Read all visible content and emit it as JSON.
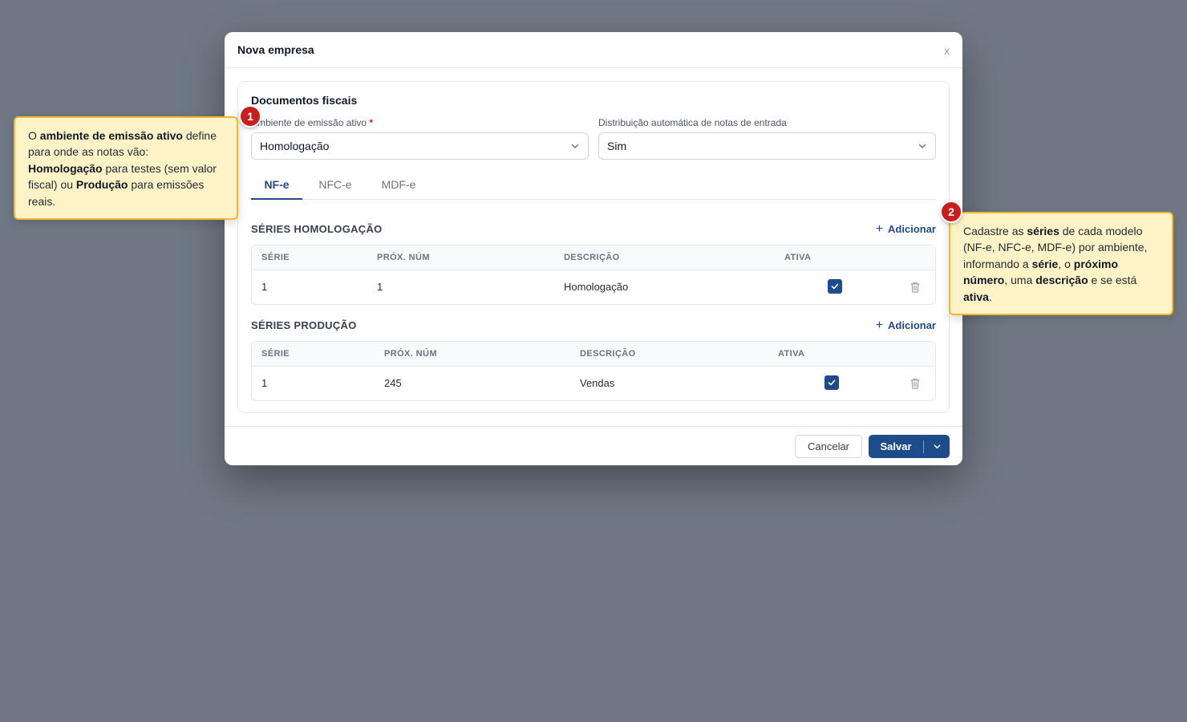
{
  "modal": {
    "title": "Nova empresa",
    "close_label": "x"
  },
  "card": {
    "title": "Documentos fiscais",
    "ambiente": {
      "label": "Ambiente de emissão ativo",
      "required_mark": "*",
      "value": "Homologação"
    },
    "distribuicao": {
      "label": "Distribuição automática de notas de entrada",
      "value": "Sim"
    },
    "tabs": [
      {
        "label": "NF-e",
        "active": true
      },
      {
        "label": "NFC-e",
        "active": false
      },
      {
        "label": "MDF-e",
        "active": false
      }
    ]
  },
  "series_homologacao": {
    "title": "SÉRIES HOMOLOGAÇÃO",
    "add_label": "Adicionar",
    "columns": [
      "SÉRIE",
      "PRÓX. NÚM",
      "DESCRIÇÃO",
      "ATIVA"
    ],
    "rows": [
      {
        "serie": "1",
        "prox_num": "1",
        "descricao": "Homologação",
        "ativa": true
      }
    ]
  },
  "series_producao": {
    "title": "SÉRIES PRODUÇÃO",
    "add_label": "Adicionar",
    "columns": [
      "SÉRIE",
      "PRÓX. NÚM",
      "DESCRIÇÃO",
      "ATIVA"
    ],
    "rows": [
      {
        "serie": "1",
        "prox_num": "245",
        "descricao": "Vendas",
        "ativa": true
      }
    ]
  },
  "footer": {
    "cancel_label": "Cancelar",
    "save_label": "Salvar"
  },
  "tooltips": [
    {
      "badge": "1",
      "segments": [
        {
          "text": "O ",
          "bold": false
        },
        {
          "text": "ambiente de emissão ativo",
          "bold": true
        },
        {
          "text": " define para onde as notas vão: ",
          "bold": false
        },
        {
          "text": "Homologação",
          "bold": true
        },
        {
          "text": " para testes (sem valor fiscal) ou ",
          "bold": false
        },
        {
          "text": "Produção",
          "bold": true
        },
        {
          "text": " para emissões reais.",
          "bold": false
        }
      ]
    },
    {
      "badge": "2",
      "segments": [
        {
          "text": "Cadastre as ",
          "bold": false
        },
        {
          "text": "séries",
          "bold": true
        },
        {
          "text": " de cada modelo (NF-e, NFC-e, MDF-e) por ambiente, informando a ",
          "bold": false
        },
        {
          "text": "série",
          "bold": true
        },
        {
          "text": ", o ",
          "bold": false
        },
        {
          "text": "próximo número",
          "bold": true
        },
        {
          "text": ", uma ",
          "bold": false
        },
        {
          "text": "descrição",
          "bold": true
        },
        {
          "text": " e se está ",
          "bold": false
        },
        {
          "text": "ativa",
          "bold": true
        },
        {
          "text": ".",
          "bold": false
        }
      ]
    }
  ],
  "colors": {
    "accent": "#1e4b8a",
    "backdrop": "#6f7884",
    "tooltip_bg": "#fef3c7",
    "tooltip_border": "#f5b732",
    "badge": "#c81e1e",
    "required": "#dc2626"
  },
  "icons": {
    "close": "close-icon",
    "dropdown": "chevron-down-icon",
    "add": "plus-icon",
    "checkbox": "check-icon",
    "delete": "trash-icon"
  }
}
